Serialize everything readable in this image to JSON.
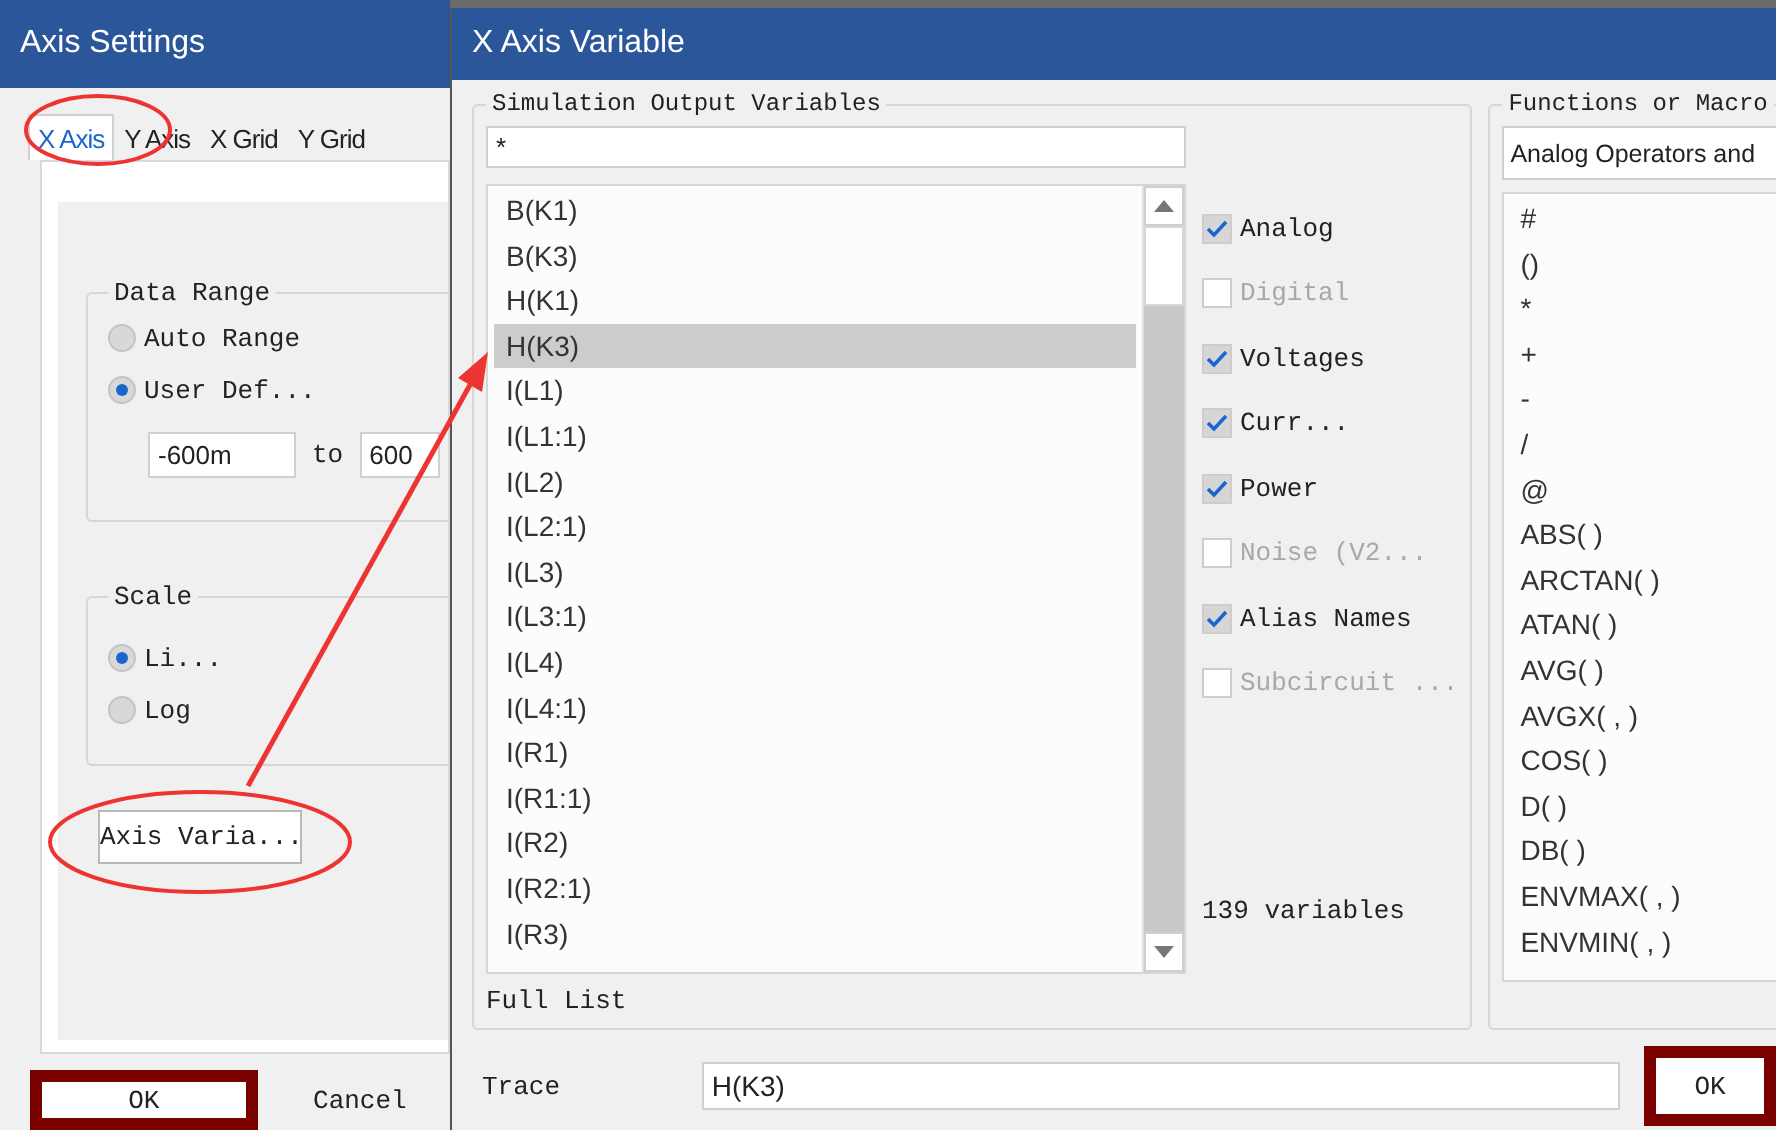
{
  "axis_settings": {
    "title": "Axis Settings",
    "tabs": [
      {
        "label": "X Axis",
        "selected": true
      },
      {
        "label": "Y Axis",
        "selected": false
      },
      {
        "label": "X Grid",
        "selected": false
      },
      {
        "label": "Y Grid",
        "selected": false
      }
    ],
    "data_range": {
      "title": "Data Range",
      "options": [
        {
          "label": "Auto Range",
          "selected": false
        },
        {
          "label": "User Def...",
          "selected": true
        }
      ],
      "from": "-600m",
      "to_label": "to",
      "to": "600"
    },
    "scale": {
      "title": "Scale",
      "options": [
        {
          "label": "Li...",
          "selected": true
        },
        {
          "label": "Log",
          "selected": false
        }
      ]
    },
    "axis_variable_button": "Axis Varia...",
    "buttons": [
      {
        "label": "OK",
        "highlighted": true
      },
      {
        "label": "Cancel",
        "highlighted": false
      }
    ]
  },
  "x_axis_variable": {
    "title": "X Axis Variable",
    "output_variables": {
      "title": "Simulation Output Variables",
      "filter": "*",
      "items": [
        {
          "label": "B(K1)",
          "selected": false
        },
        {
          "label": "B(K3)",
          "selected": false
        },
        {
          "label": "H(K1)",
          "selected": false
        },
        {
          "label": "H(K3)",
          "selected": true
        },
        {
          "label": "I(L1)",
          "selected": false
        },
        {
          "label": "I(L1:1)",
          "selected": false
        },
        {
          "label": "I(L2)",
          "selected": false
        },
        {
          "label": "I(L2:1)",
          "selected": false
        },
        {
          "label": "I(L3)",
          "selected": false
        },
        {
          "label": "I(L3:1)",
          "selected": false
        },
        {
          "label": "I(L4)",
          "selected": false
        },
        {
          "label": "I(L4:1)",
          "selected": false
        },
        {
          "label": "I(R1)",
          "selected": false
        },
        {
          "label": "I(R1:1)",
          "selected": false
        },
        {
          "label": "I(R2)",
          "selected": false
        },
        {
          "label": "I(R2:1)",
          "selected": false
        },
        {
          "label": "I(R3)",
          "selected": false
        }
      ],
      "options": [
        {
          "label": "Analog",
          "checked": true,
          "disabled": false
        },
        {
          "label": "Digital",
          "checked": false,
          "disabled": true
        },
        {
          "label": "Voltages",
          "checked": true,
          "disabled": false
        },
        {
          "label": "Curr...",
          "checked": true,
          "disabled": false
        },
        {
          "label": "Power",
          "checked": true,
          "disabled": false
        },
        {
          "label": "Noise (V2...",
          "checked": false,
          "disabled": true
        },
        {
          "label": "Alias Names",
          "checked": true,
          "disabled": false
        },
        {
          "label": "Subcircuit ...",
          "checked": false,
          "disabled": true
        }
      ],
      "count": "139 variables",
      "footer": "Full List"
    },
    "functions": {
      "title": "Functions or Macro",
      "category": "Analog Operators and",
      "items": [
        "#",
        "()",
        "*",
        "+",
        "-",
        "/",
        "@",
        "ABS( )",
        "ARCTAN( )",
        "ATAN( )",
        "AVG( )",
        "AVGX( , )",
        "COS( )",
        "D( )",
        "DB( )",
        "ENVMAX( , )",
        "ENVMIN( , )"
      ]
    },
    "trace_label": "Trace",
    "trace": "H(K3)",
    "ok": {
      "label": "OK",
      "highlighted": true
    }
  }
}
